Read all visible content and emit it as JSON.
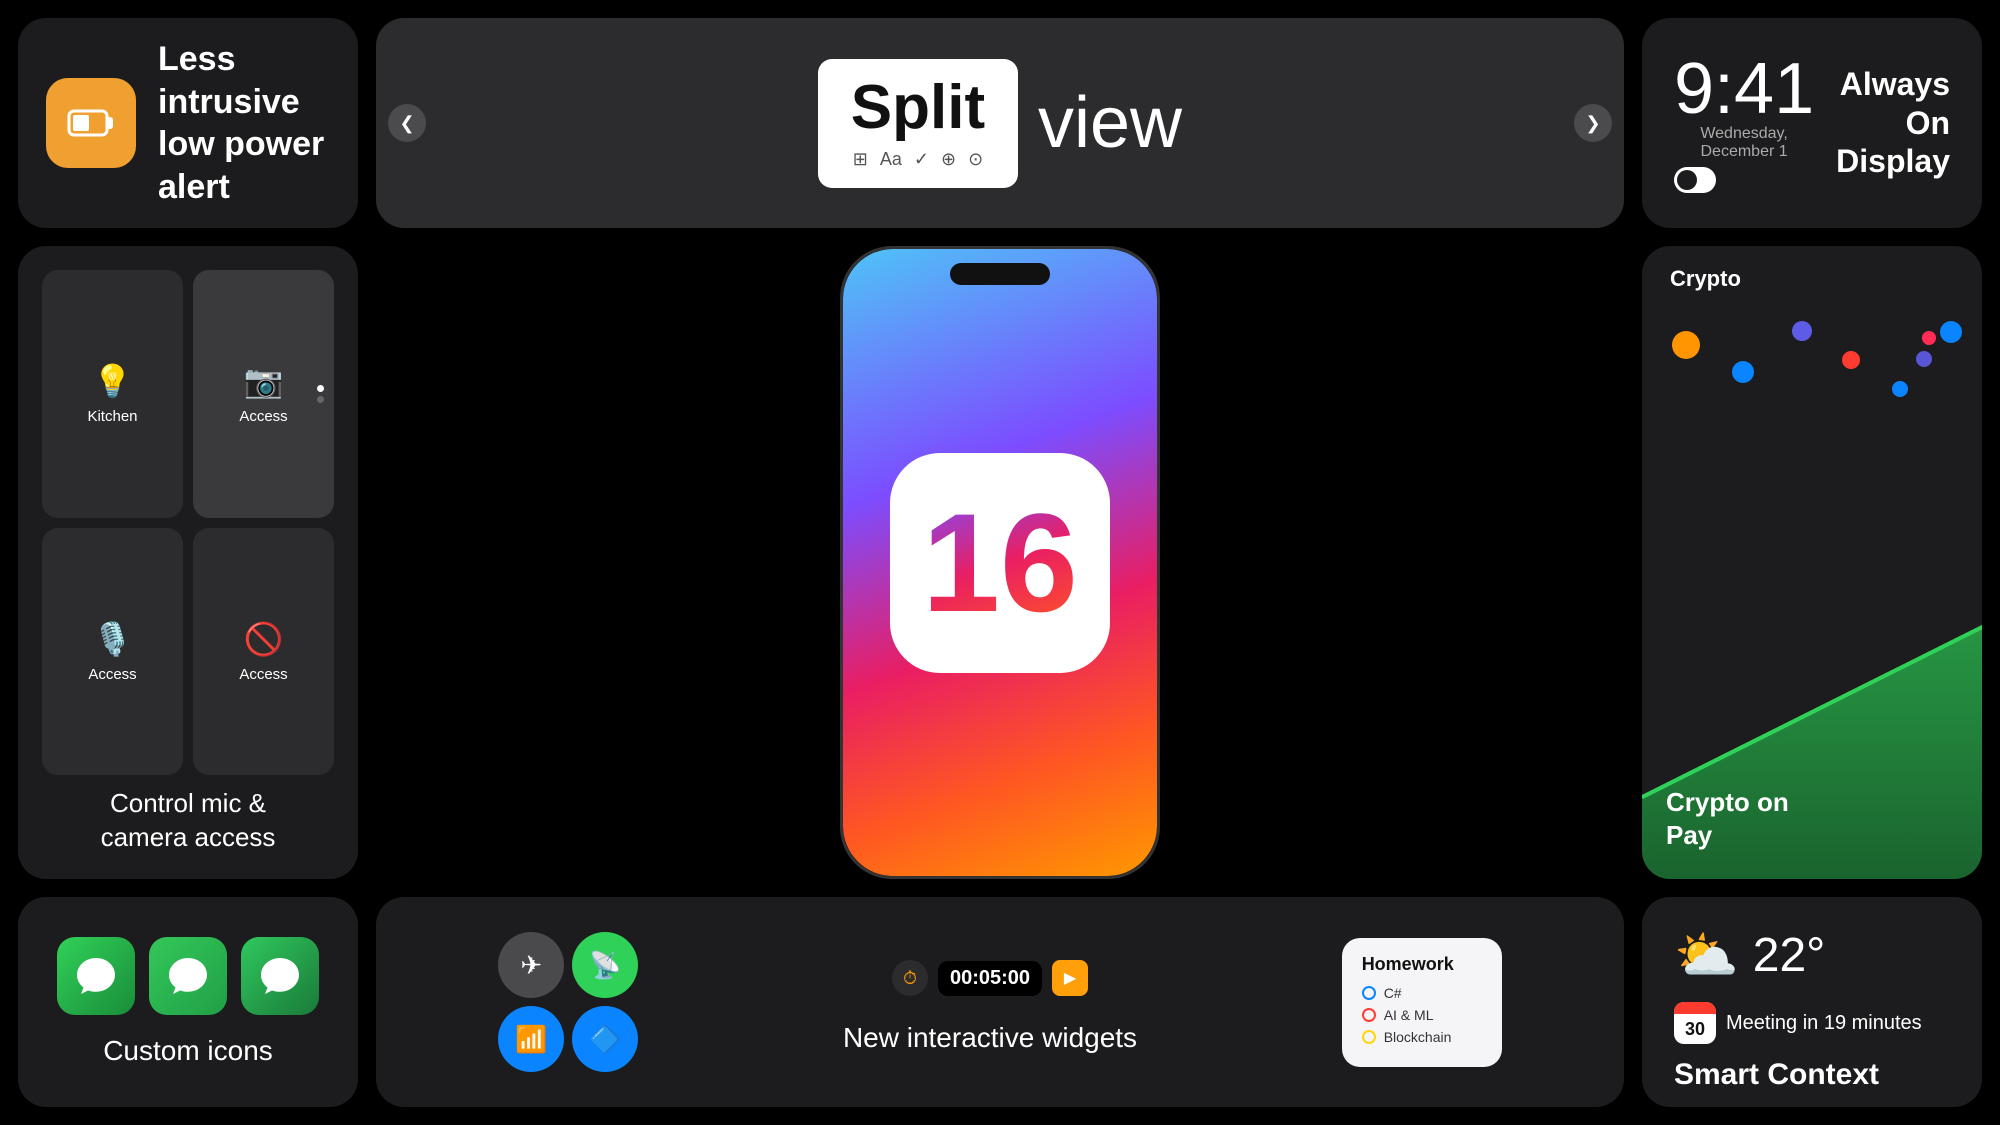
{
  "cards": {
    "low_power": {
      "title": "Less intrusive low power alert"
    },
    "split_view": {
      "split_text": "Split",
      "view_text": "view"
    },
    "aod": {
      "time": "9:41",
      "day_label": "Wednesday, December 1",
      "toggle_state": "on",
      "label": "Always On Display"
    },
    "access": {
      "cells": [
        {
          "label": "Kitchen",
          "icon": "💡"
        },
        {
          "label": "Access",
          "icon": "📷"
        },
        {
          "label": "Access",
          "icon": "🎙️"
        },
        {
          "label": "Access",
          "icon": "🚫"
        }
      ],
      "footer": "Control mic &\ncamera access"
    },
    "crypto": {
      "apple_symbol": "",
      "title": "Crypto",
      "footer_line1": "Crypto on",
      "footer_line2": " Pay"
    },
    "custom_icons": {
      "label": "Custom icons"
    },
    "widgets": {
      "timer_value": "00:05:00",
      "homework_title": "Homework",
      "homework_items": [
        {
          "label": "C#",
          "color": "blue"
        },
        {
          "label": "AI & ML",
          "color": "red"
        },
        {
          "label": "Blockchain",
          "color": "yellow"
        }
      ],
      "label": "New interactive widgets"
    },
    "smart_context": {
      "temperature": "22°",
      "meeting_text": "Meeting in 19 minutes",
      "calendar_day": "30",
      "label": "Smart Context"
    }
  }
}
